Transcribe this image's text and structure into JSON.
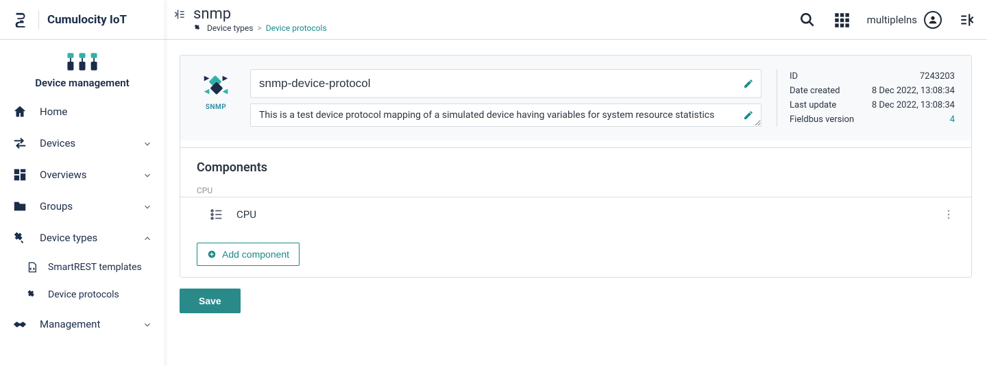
{
  "brand": {
    "name": "Cumulocity IoT",
    "context": "Device management"
  },
  "sidebar": {
    "items": [
      {
        "label": "Home",
        "icon": "home"
      },
      {
        "label": "Devices",
        "icon": "arrows"
      },
      {
        "label": "Overviews",
        "icon": "dashboard"
      },
      {
        "label": "Groups",
        "icon": "folder"
      },
      {
        "label": "Device types",
        "icon": "plug"
      },
      {
        "label": "Management",
        "icon": "handshake"
      }
    ],
    "deviceTypesChildren": [
      {
        "label": "SmartREST templates"
      },
      {
        "label": "Device protocols"
      }
    ]
  },
  "topbar": {
    "title": "snmp",
    "breadcrumb": {
      "root": "Device types",
      "leaf": "Device protocols"
    },
    "user": "multiplelns"
  },
  "protocol": {
    "type_label": "SNMP",
    "name": "snmp-device-protocol",
    "description": "This is a test device protocol mapping of a simulated device having variables for system resource statistics"
  },
  "meta": {
    "id_label": "ID",
    "id_value": "7243203",
    "created_label": "Date created",
    "created_value": "8 Dec 2022, 13:08:34",
    "updated_label": "Last update",
    "updated_value": "8 Dec 2022, 13:08:34",
    "fieldbus_label": "Fieldbus version",
    "fieldbus_value": "4"
  },
  "components": {
    "title": "Components",
    "group_label": "CPU",
    "rows": [
      {
        "label": "CPU"
      }
    ],
    "add_label": "Add component"
  },
  "actions": {
    "save": "Save"
  }
}
